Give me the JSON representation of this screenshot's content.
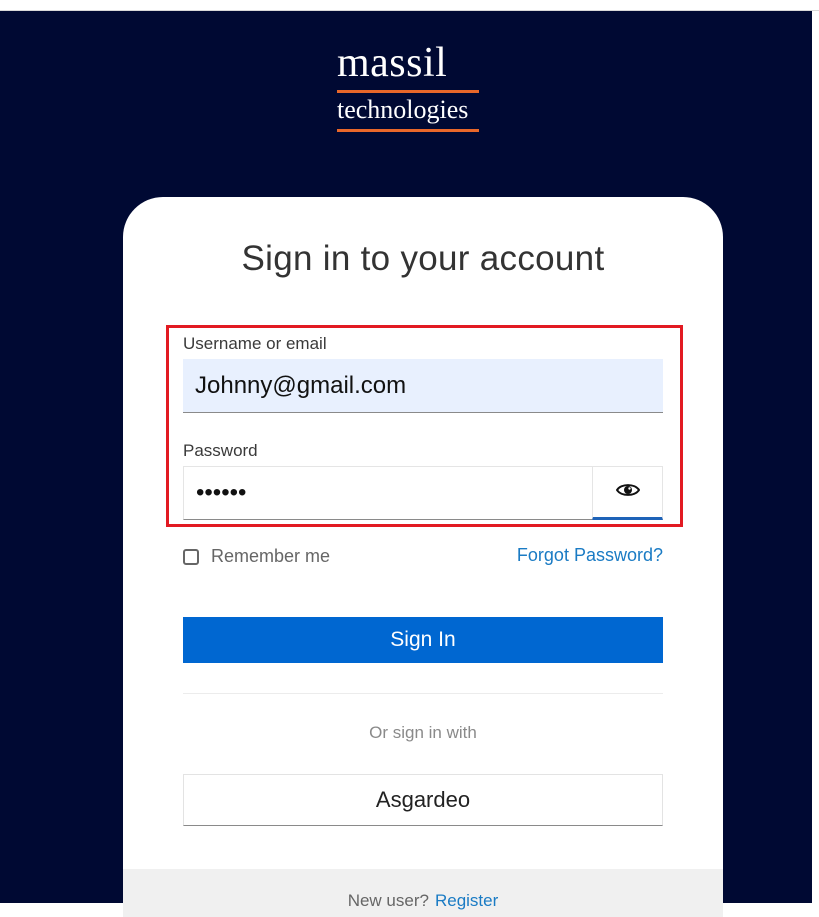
{
  "logo": {
    "name": "massil",
    "subtitle": "technologies"
  },
  "login": {
    "title": "Sign in to your account",
    "username_label": "Username or email",
    "username_value": "Johnny@gmail.com",
    "password_label": "Password",
    "password_value": "••••••",
    "password_toggle_icon": "eye-icon",
    "remember_label": "Remember me",
    "remember_checked": false,
    "forgot_label": "Forgot Password?",
    "signin_label": "Sign In",
    "or_text": "Or sign in with",
    "asgardeo_label": "Asgardeo",
    "new_user_text": "New user?",
    "register_label": "Register"
  },
  "colors": {
    "background": "#000933",
    "primary_button": "#0067d1",
    "link": "#1a7bc4",
    "highlight_box": "#e21a22",
    "logo_accent": "#e8672a"
  }
}
